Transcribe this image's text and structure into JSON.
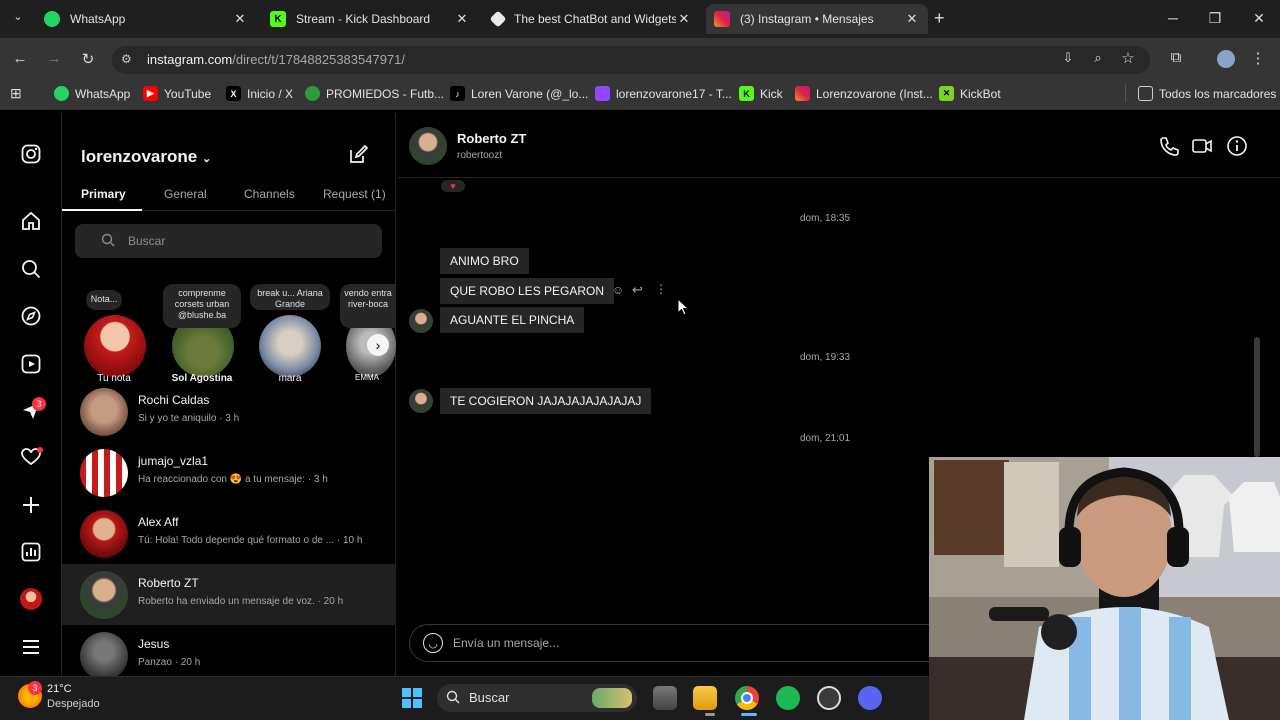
{
  "browser": {
    "tabs": [
      {
        "title": "WhatsApp",
        "icon": "whatsapp-icon",
        "color": "#25d366"
      },
      {
        "title": "Stream - Kick Dashboard",
        "icon": "kick-icon",
        "color": "#53fc18"
      },
      {
        "title": "The best ChatBot and Widgets f",
        "icon": "chatbot-icon",
        "color": "#ffffff"
      },
      {
        "title": "(3) Instagram • Mensajes",
        "icon": "instagram-icon",
        "color": "#e1306c"
      }
    ],
    "url_main": "instagram.com",
    "url_path": "/direct/t/17848825383547971/",
    "bookmarks": [
      {
        "label": "WhatsApp",
        "color": "#25d366"
      },
      {
        "label": "YouTube",
        "color": "#ff0000"
      },
      {
        "label": "Inicio / X",
        "color": "#000000"
      },
      {
        "label": "PROMIEDOS - Futb...",
        "color": "#2e9b3a"
      },
      {
        "label": "Loren Varone (@_lo...",
        "color": "#000000"
      },
      {
        "label": "lorenzovarone17 - T...",
        "color": "#9146ff"
      },
      {
        "label": "Kick",
        "color": "#53fc18"
      },
      {
        "label": "Lorenzovarone (Inst...",
        "color": "#e1306c"
      },
      {
        "label": "KickBot",
        "color": "#7dd321"
      }
    ],
    "all_bookmarks": "Todos los marcadores"
  },
  "inbox": {
    "username": "lorenzovarone",
    "tabs": [
      "Primary",
      "General",
      "Channels",
      "Request (1)"
    ],
    "search_placeholder": "Buscar",
    "notes": [
      {
        "bubble": "Nota...",
        "name": "Tu nota"
      },
      {
        "bubble": "comprenme corsets urban @blushe.ba",
        "name": "Sol Agostina"
      },
      {
        "bubble": "break u... Ariana Grande",
        "name": "mara"
      },
      {
        "bubble": "vendo entra river-boca",
        "name": "EMMA"
      }
    ],
    "conversations": [
      {
        "name": "Rochi Caldas",
        "preview": "Si y yo te aniquilo · 3 h"
      },
      {
        "name": "jumajo_vzla1",
        "preview": "Ha reaccionado con 😍 a tu mensaje: · 3 h"
      },
      {
        "name": "Alex Aff",
        "preview": "Tú: Hola! Todo depende qué formato o de ... · 10 h"
      },
      {
        "name": "Roberto ZT",
        "preview": "Roberto ha enviado un mensaje de voz. · 20 h"
      },
      {
        "name": "Jesus",
        "preview": "Panzao · 20 h"
      }
    ]
  },
  "rail": {
    "badge_count": "3"
  },
  "chat": {
    "name": "Roberto ZT",
    "username": "robertoozt",
    "stamps": [
      "dom, 18:35",
      "dom, 19:33",
      "dom, 21:01"
    ],
    "messages": [
      "ANIMO BRO",
      "QUE ROBO LES PEGARON",
      "AGUANTE EL PINCHA",
      "TE COGIERON JAJAJAJAJAJAJAJ"
    ],
    "composer_placeholder": "Envía un mensaje..."
  },
  "taskbar": {
    "weather_temp": "21°C",
    "weather_desc": "Despejado",
    "weather_badge": "3",
    "search": "Buscar"
  },
  "colors": {
    "instagram_bg": "#000000",
    "bubble": "#262626",
    "badge": "#ff3040"
  }
}
